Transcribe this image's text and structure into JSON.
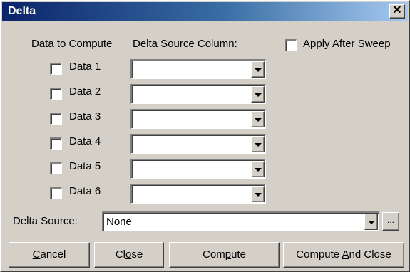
{
  "window": {
    "title": "Delta",
    "close_glyph": "✕"
  },
  "headers": {
    "data_to_compute": "Data to Compute",
    "delta_source_column": "Delta Source Column:"
  },
  "apply_after_sweep": {
    "label": "Apply After Sweep",
    "checked": false
  },
  "data_rows": [
    {
      "label": "Data 1",
      "checked": false,
      "column_value": ""
    },
    {
      "label": "Data 2",
      "checked": false,
      "column_value": ""
    },
    {
      "label": "Data 3",
      "checked": false,
      "column_value": ""
    },
    {
      "label": "Data 4",
      "checked": false,
      "column_value": ""
    },
    {
      "label": "Data 5",
      "checked": false,
      "column_value": ""
    },
    {
      "label": "Data 6",
      "checked": false,
      "column_value": ""
    }
  ],
  "delta_source": {
    "label": "Delta Source:",
    "value": "None",
    "browse_label": "..."
  },
  "buttons": {
    "cancel": {
      "pre": "",
      "mn": "C",
      "post": "ancel"
    },
    "close": {
      "pre": "Cl",
      "mn": "o",
      "post": "se"
    },
    "compute": {
      "pre": "Com",
      "mn": "p",
      "post": "ute"
    },
    "compute_and_close": {
      "pre": "Compute ",
      "mn": "A",
      "post": "nd Close"
    }
  },
  "icons": {
    "close": "close-icon",
    "dropdown": "chevron-down-icon"
  },
  "colors": {
    "face": "#d4d0c8",
    "title_start": "#0a246a",
    "title_end": "#a6caf0"
  }
}
